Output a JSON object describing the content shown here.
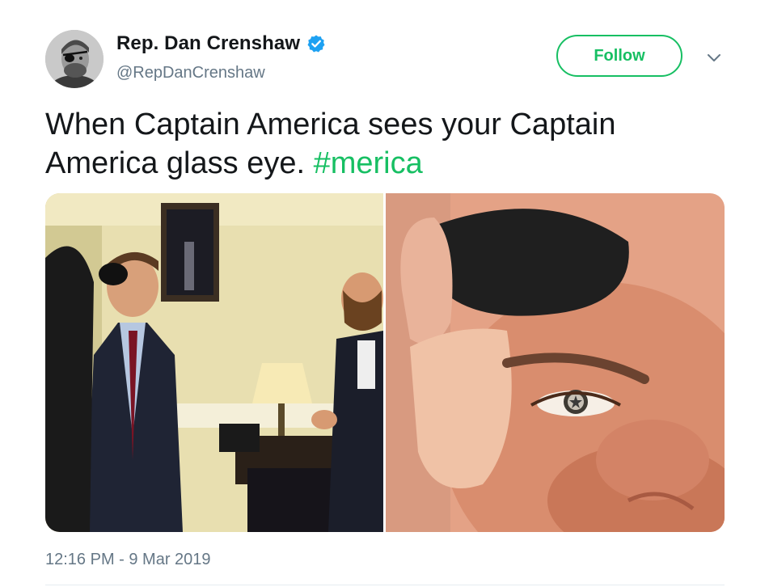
{
  "author": {
    "display_name": "Rep. Dan Crenshaw",
    "handle": "@RepDanCrenshaw",
    "verified": true,
    "avatar_icon": "profile-photo"
  },
  "actions": {
    "follow_label": "Follow",
    "menu_icon": "chevron-down-icon"
  },
  "tweet": {
    "text": "When Captain America sees your Captain America glass eye. ",
    "hashtag": "#merica",
    "timestamp": "12:16 PM - 9 Mar 2019"
  },
  "media": {
    "photos": [
      {
        "description_icon": "photo-office-group"
      },
      {
        "description_icon": "photo-eye-closeup"
      }
    ]
  },
  "colors": {
    "accent": "#17bf63",
    "verified_blue": "#1da1f2",
    "text_primary": "#14171a",
    "text_secondary": "#657786"
  }
}
